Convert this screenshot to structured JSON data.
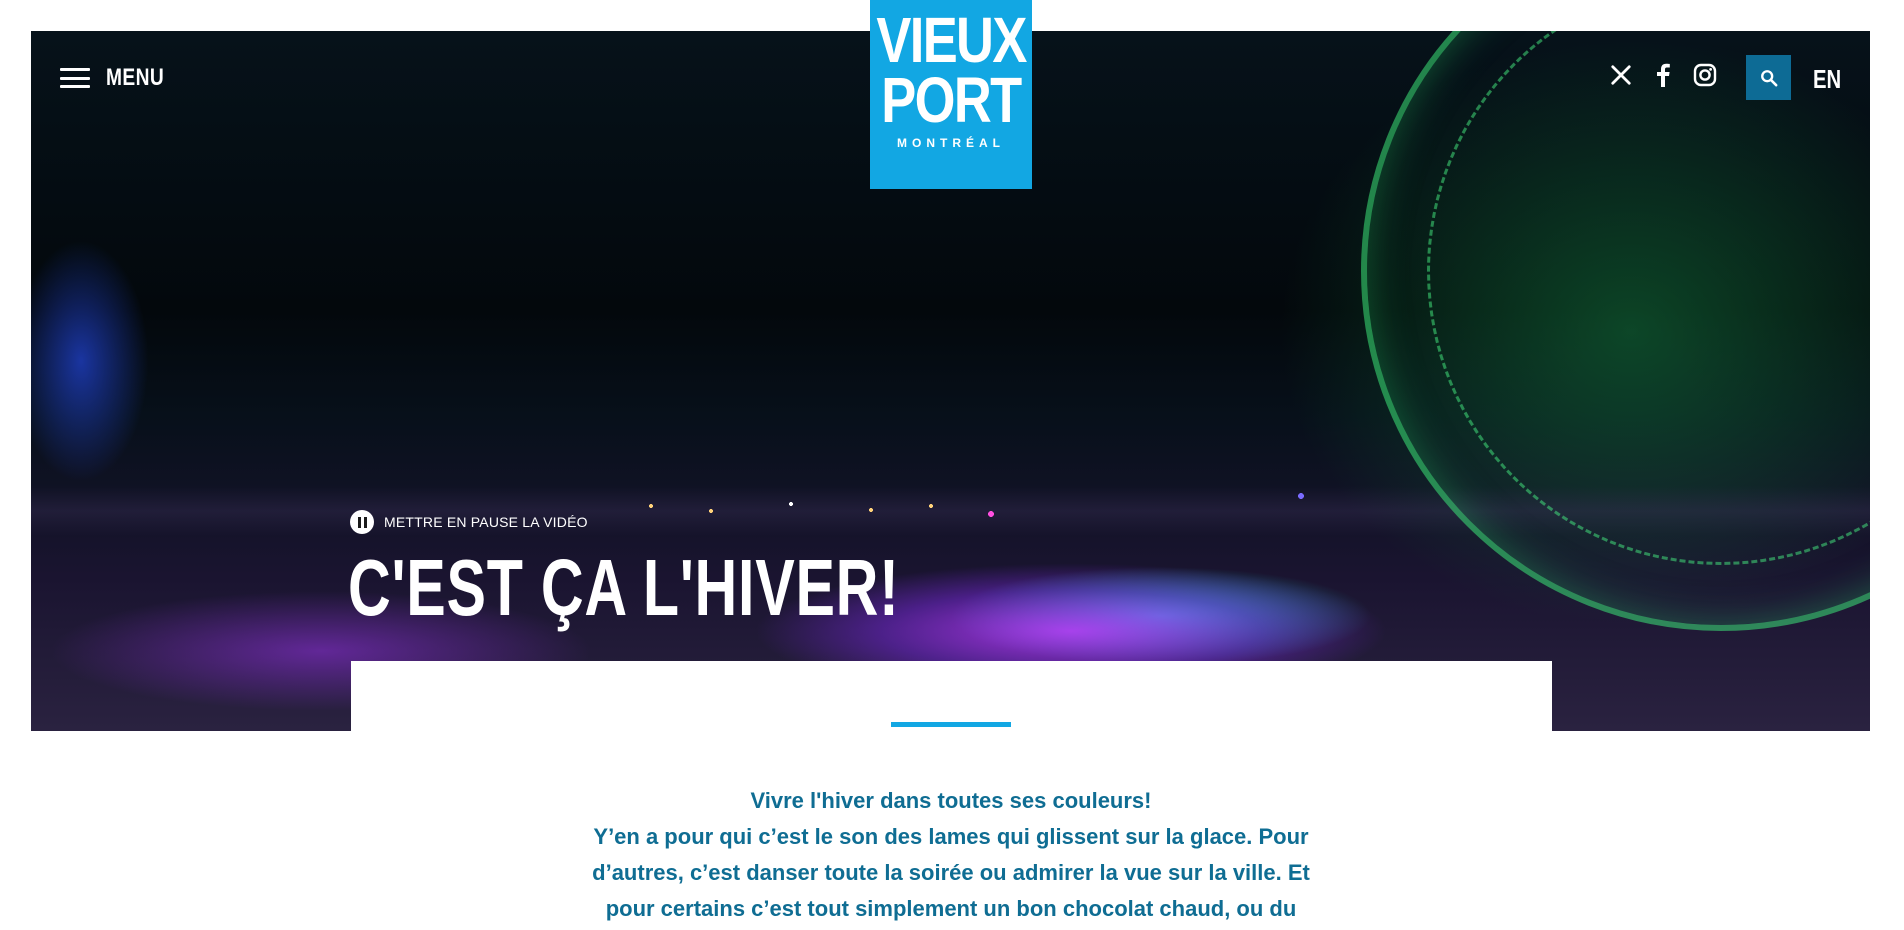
{
  "header": {
    "menu_label": "MENU",
    "logo": {
      "line1": "VIEUX",
      "line2": "PORT",
      "city": "MONTRÉAL"
    },
    "social": [
      {
        "icon": "x-twitter-icon"
      },
      {
        "icon": "facebook-icon"
      },
      {
        "icon": "instagram-icon"
      }
    ],
    "search_icon": "search-icon",
    "lang_label": "EN"
  },
  "hero": {
    "pause_label": "METTRE EN PAUSE LA VIDÉO",
    "title": "C'EST ÇA L'HIVER!"
  },
  "intro": {
    "heading": "Vivre l'hiver dans toutes ses couleurs!",
    "line1": "Y’en a pour qui c’est le son des lames qui glissent sur la glace. Pour",
    "line2": "d’autres, c’est danser toute la soirée ou admirer la vue sur la ville. Et",
    "line3": "pour certains c’est tout simplement un bon chocolat chaud, ou du"
  },
  "colors": {
    "brand_blue": "#12a7e3",
    "search_bg": "#0d6b95",
    "text_blue": "#0f6d93"
  }
}
